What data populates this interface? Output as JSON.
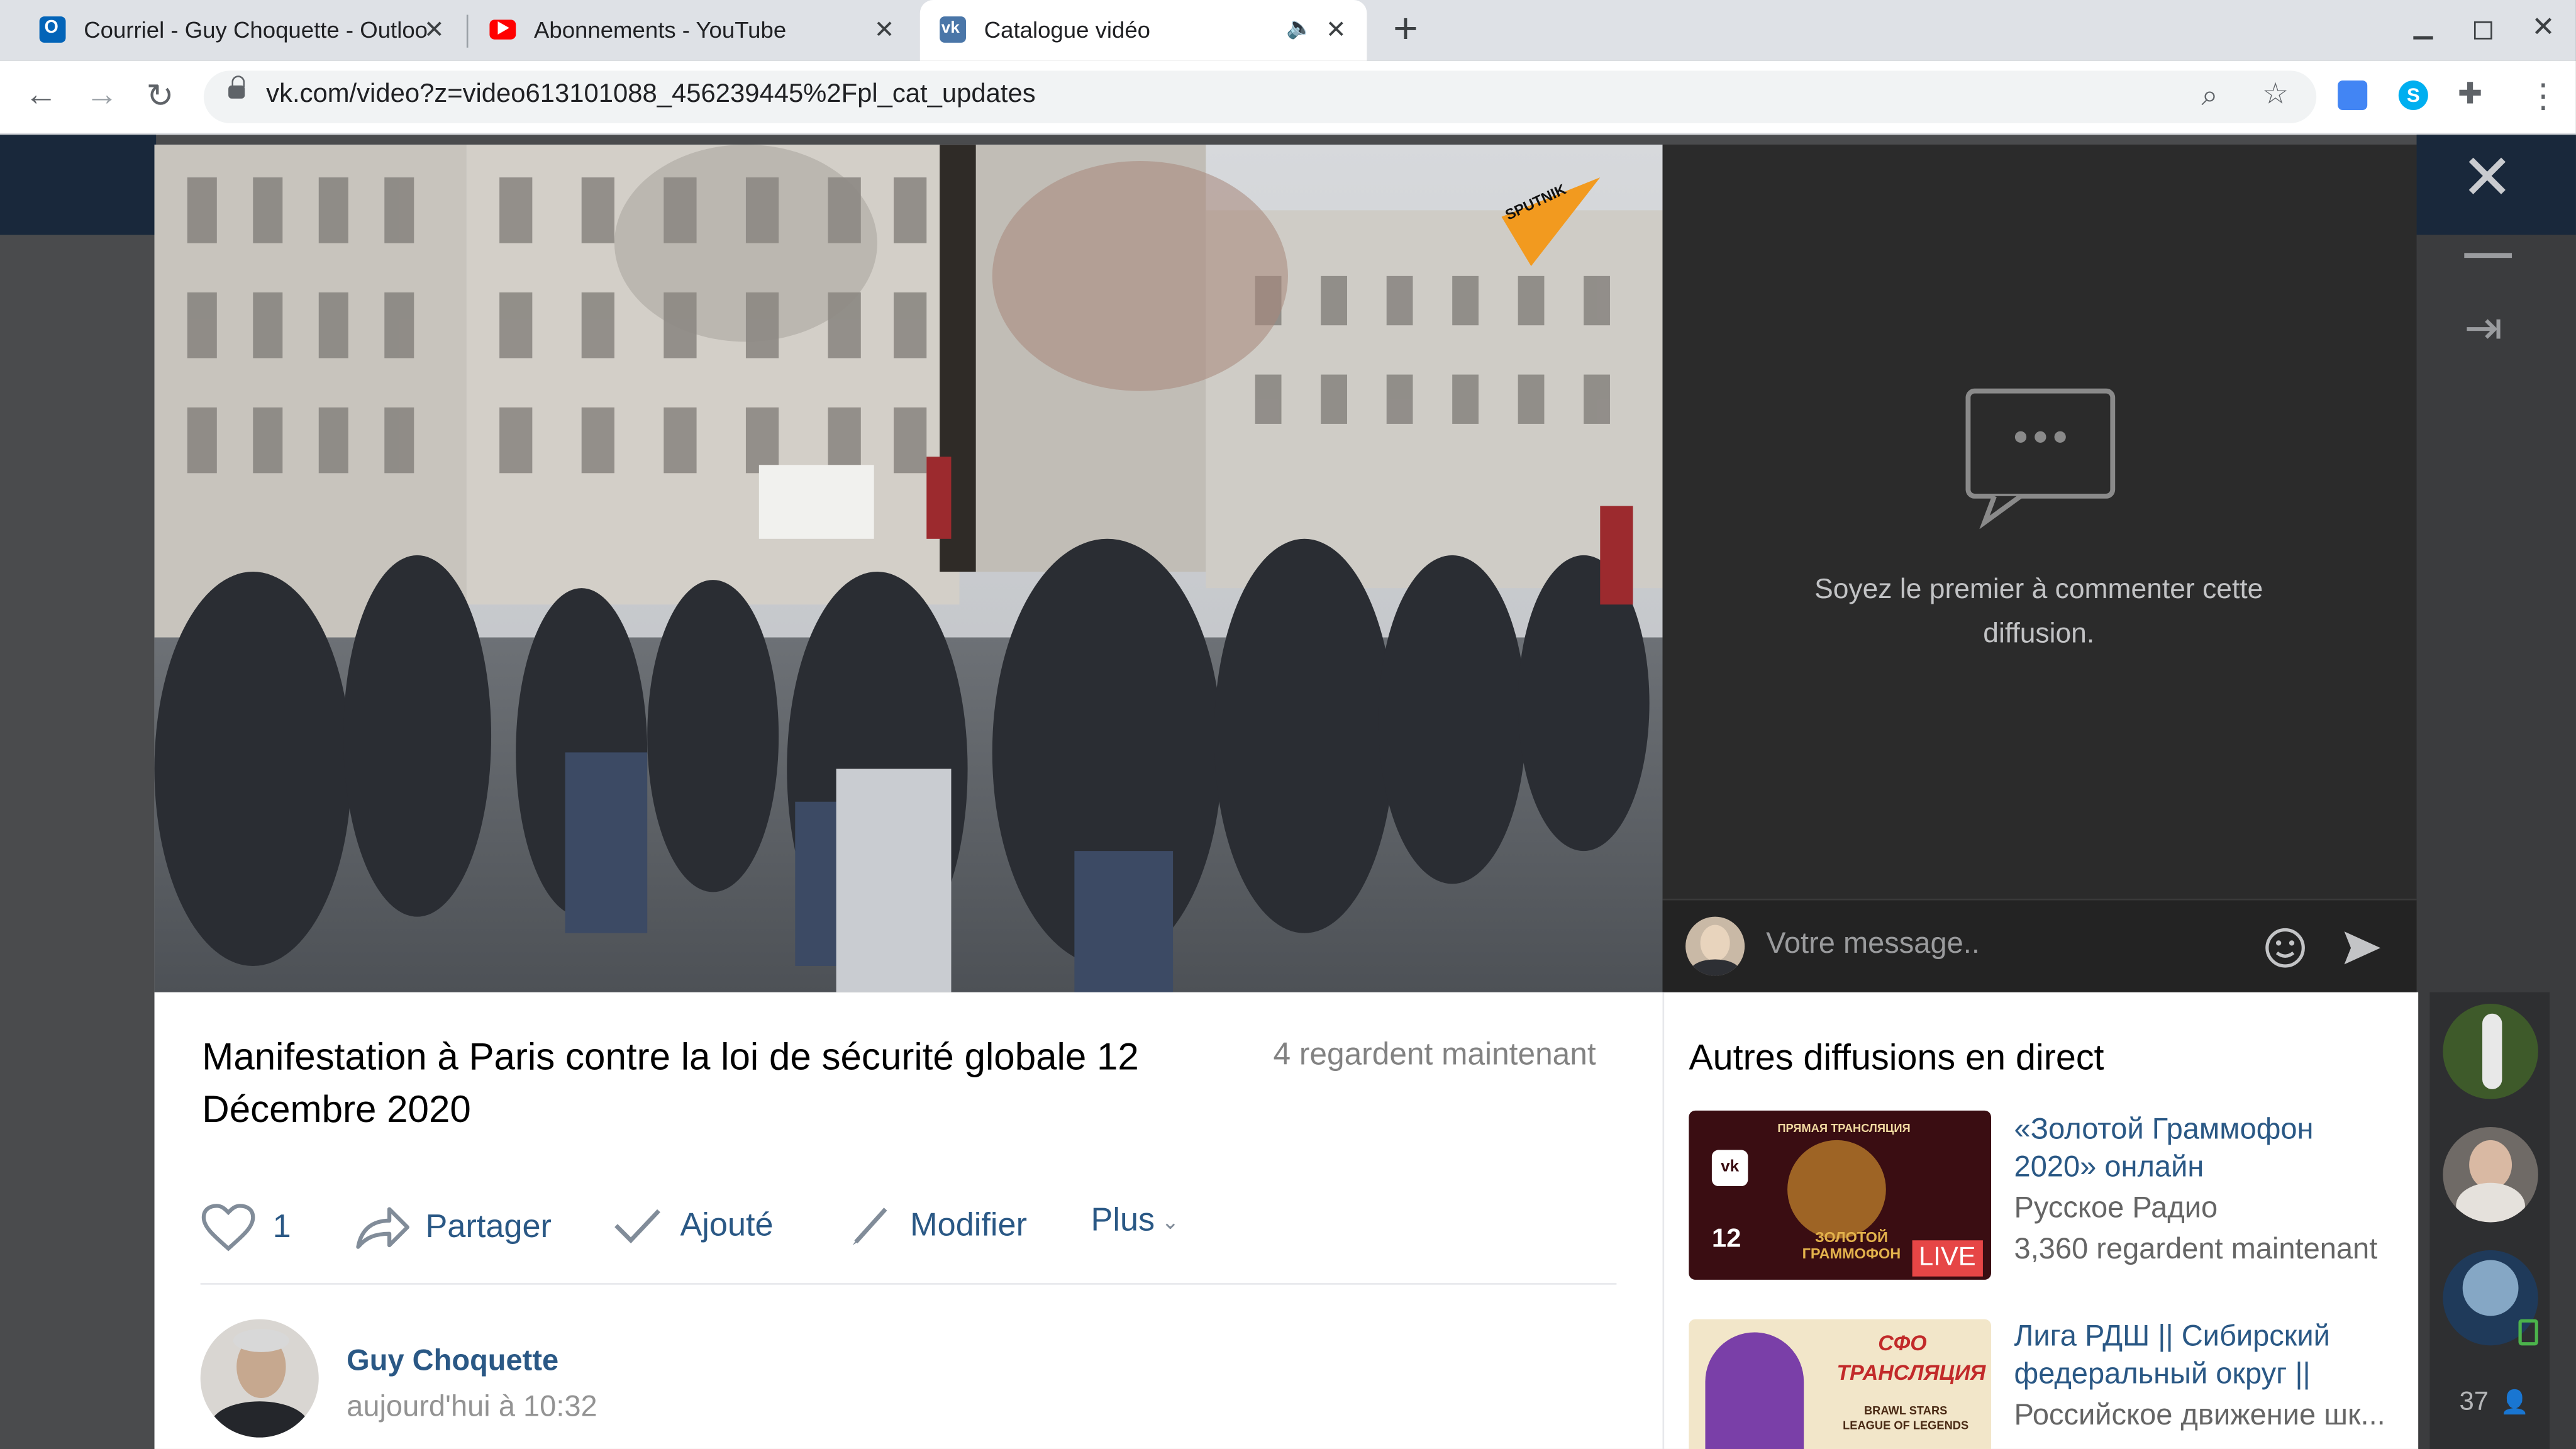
{
  "browser": {
    "tabs": [
      {
        "title": "Courriel - Guy Choquette - Outlook",
        "favicon": "outlook-icon"
      },
      {
        "title": "Abonnements - YouTube",
        "favicon": "youtube-icon"
      },
      {
        "title": "Catalogue vidéo",
        "favicon": "vk-icon",
        "audio": true
      }
    ],
    "url": "vk.com/video?z=video613101088_456239445%2Fpl_cat_updates",
    "new_tab_label": "+"
  },
  "video": {
    "watermark": "SPUTNIK",
    "title": "Manifestation à Paris contre la loi de sécurité globale 12 Décembre 2020",
    "viewers": "4 regardent maintenant"
  },
  "chat": {
    "empty_text": "Soyez le premier à commenter cette diffusion.",
    "input_placeholder": "Votre message.."
  },
  "actions": {
    "likes": "1",
    "share": "Partager",
    "added": "Ajouté",
    "edit": "Modifier",
    "more": "Plus"
  },
  "author": {
    "name": "Guy Choquette",
    "time": "aujourd'hui à 10:32"
  },
  "other_streams": {
    "heading": "Autres diffusions en direct",
    "items": [
      {
        "title": "«Золотой Граммофон 2020» онлайн",
        "channel": "Русское Радио",
        "viewers": "3,360 regardent maintenant",
        "thumb_top": "ПРЯМАЯ ТРАНСЛЯЦИЯ",
        "thumb_brand": "ЗОЛОТОЙ ГРАММОФОН",
        "thumb_date": "12",
        "badge": "LIVE"
      },
      {
        "title": "Лига РДШ || Сибирский федеральный округ ||",
        "channel": "Российское движение шк...",
        "thumb_top": "СФО ТРАНСЛЯЦИЯ",
        "thumb_brand": "BRAWL STARS LEAGUE OF LEGENDS"
      }
    ]
  },
  "sidebar": {
    "count": "37"
  },
  "colors": {
    "vk_link": "#2a5885",
    "live_badge": "#e64646",
    "chat_bg": "#2b2b2b"
  }
}
